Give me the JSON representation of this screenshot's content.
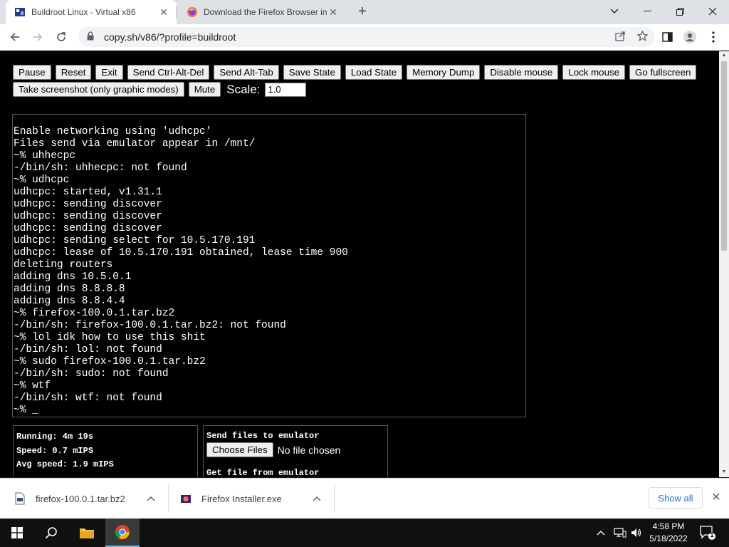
{
  "browser": {
    "tabs": [
      {
        "title": "Buildroot Linux - Virtual x86",
        "icon": "v86-icon",
        "active": true
      },
      {
        "title": "Download the Firefox Browser in",
        "icon": "firefox-icon",
        "active": false
      }
    ],
    "address": "copy.sh/v86/?profile=buildroot"
  },
  "emulator": {
    "buttons_row1": [
      "Pause",
      "Reset",
      "Exit",
      "Send Ctrl-Alt-Del",
      "Send Alt-Tab",
      "Save State",
      "Load State",
      "Memory Dump",
      "Disable mouse",
      "Lock mouse",
      "Go fullscreen"
    ],
    "buttons_row2": [
      "Take screenshot (only graphic modes)",
      "Mute"
    ],
    "scale_label": "Scale:",
    "scale_value": "1.0",
    "terminal_lines": [
      "Enable networking using 'udhcpc'",
      "Files send via emulator appear in /mnt/",
      "~% uhhecpc",
      "-/bin/sh: uhhecpc: not found",
      "~% udhcpc",
      "udhcpc: started, v1.31.1",
      "udhcpc: sending discover",
      "udhcpc: sending discover",
      "udhcpc: sending discover",
      "udhcpc: sending select for 10.5.170.191",
      "udhcpc: lease of 10.5.170.191 obtained, lease time 900",
      "deleting routers",
      "adding dns 10.5.0.1",
      "adding dns 8.8.8.8",
      "adding dns 8.8.4.4",
      "~% firefox-100.0.1.tar.bz2",
      "-/bin/sh: firefox-100.0.1.tar.bz2: not found",
      "~% lol idk how to use this shit",
      "-/bin/sh: lol: not found",
      "~% sudo firefox-100.0.1.tar.bz2",
      "-/bin/sh: sudo: not found",
      "~% wtf",
      "-/bin/sh: wtf: not found",
      "~% _"
    ],
    "stats": {
      "running": "Running: 4m 19s",
      "speed": "Speed: 0.7 mIPS",
      "avg_speed": "Avg speed: 1.9 mIPS"
    },
    "files": {
      "send_label": "Send files to emulator",
      "choose_label": "Choose Files",
      "no_file": "No file chosen",
      "get_label": "Get file from emulator"
    }
  },
  "downloads": {
    "items": [
      {
        "name": "firefox-100.0.1.tar.bz2",
        "icon": "archive-file-icon"
      },
      {
        "name": "Firefox Installer.exe",
        "icon": "installer-icon"
      }
    ],
    "show_all": "Show all"
  },
  "taskbar": {
    "time": "4:58 PM",
    "date": "5/18/2022",
    "notification_count": "1"
  },
  "colors": {
    "accent": "#1a73e8",
    "page_bg": "#000000",
    "tabstrip_bg": "#dee1e6"
  }
}
